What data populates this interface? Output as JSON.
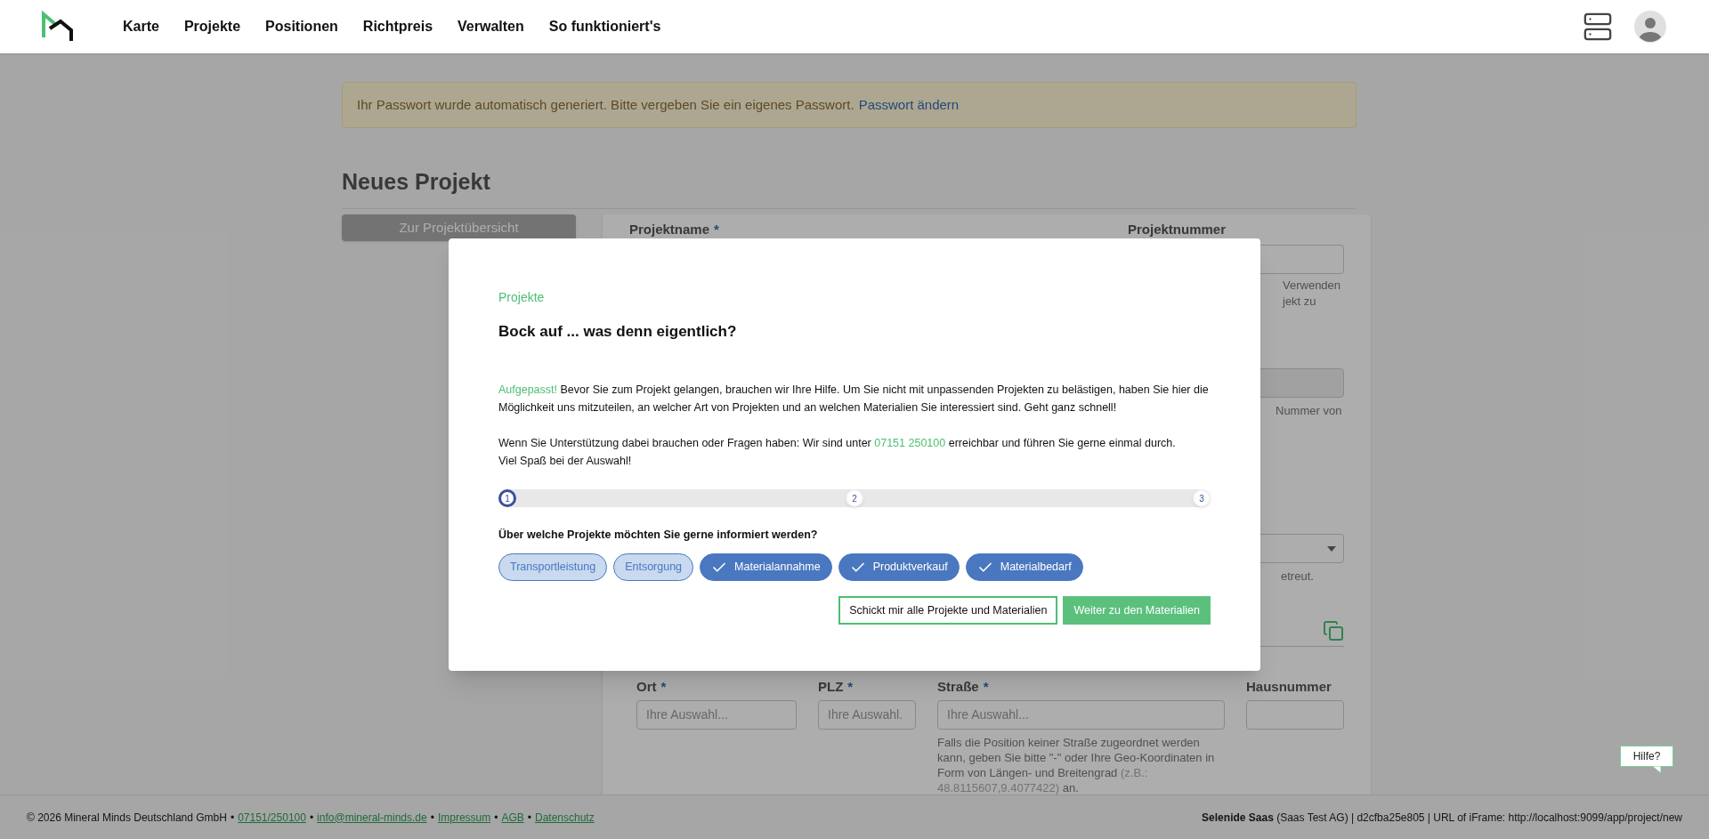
{
  "nav": {
    "items": [
      "Karte",
      "Projekte",
      "Positionen",
      "Richtpreis",
      "Verwalten",
      "So funktioniert's"
    ]
  },
  "alert": {
    "text": "Ihr Passwort wurde automatisch generiert. Bitte vergeben Sie ein eigenes Passwort.",
    "link": "Passwort ändern"
  },
  "page_title": "Neues Projekt",
  "back_button": "Zur Projektübersicht",
  "form": {
    "name_label": "Projektname",
    "name_marker": "*",
    "number_label": "Projektnummer",
    "number_hint_lines": [
      "Verwenden",
      "jekt zu"
    ],
    "second_hint": "Nummer von",
    "select_hint": "etreut.",
    "address_fields": [
      {
        "label": "Ort",
        "marker": "*",
        "placeholder": "Ihre Auswahl..."
      },
      {
        "label": "PLZ",
        "marker": "*",
        "placeholder": "Ihre Auswahl."
      },
      {
        "label": "Straße",
        "marker": "*",
        "placeholder": "Ihre Auswahl...",
        "hint": "Falls die Position keiner Straße zugeordnet werden kann, geben Sie bitte \"-\" oder Ihre Geo-Koordinaten in Form von Längen- und Breitengrad",
        "hint_example": "(z.B.: 48.8115607,9.4077422)",
        "hint_end": "an."
      },
      {
        "label": "Hausnummer"
      }
    ]
  },
  "modal": {
    "section": "Projekte",
    "title": "Bock auf ... was denn eigentlich?",
    "intro_lead": "Aufgepasst!",
    "intro": "Bevor Sie zum Projekt gelangen, brauchen wir Ihre Hilfe. Um Sie nicht mit unpassenden Projekten zu belästigen, haben Sie hier die Möglichkeit uns mitzuteilen, an welcher Art von Projekten und an welchen Materialien Sie interessiert sind. Geht ganz schnell!",
    "support_before": "Wenn Sie Unterstützung dabei brauchen oder Fragen haben: Wir sind unter",
    "phone": "07151 250100",
    "support_after": "erreichbar und führen Sie gerne einmal durch.",
    "closing": "Viel Spaß bei der Auswahl!",
    "steps": [
      {
        "label": "1",
        "selected": true
      },
      {
        "label": "2",
        "selected": false
      },
      {
        "label": "3",
        "selected": false
      }
    ],
    "question": "Über welche Projekte möchten Sie gerne informiert werden?",
    "chips": [
      {
        "label": "Transportleistung",
        "selected": false
      },
      {
        "label": "Entsorgung",
        "selected": false
      },
      {
        "label": "Materialannahme",
        "selected": true
      },
      {
        "label": "Produktverkauf",
        "selected": true
      },
      {
        "label": "Materialbedarf",
        "selected": true
      }
    ],
    "buttons": [
      {
        "kind": "outline",
        "label": "Schickt mir alle Projekte und Materialien"
      },
      {
        "kind": "primary",
        "label": "Weiter zu den Materialien"
      }
    ]
  },
  "help_bubble": "Hilfe?",
  "footer": {
    "copyright": "© 2026 Mineral Minds Deutschland GmbH",
    "separator": "•",
    "links": [
      "07151/250100",
      "info@mineral-minds.de",
      "Impressum",
      "AGB",
      "Datenschutz"
    ],
    "right": "**Selenide Saas** (Saas Test AG) | d2cfba25e805 | URL of iFrame: http://localhost:9099/app/project/new"
  }
}
